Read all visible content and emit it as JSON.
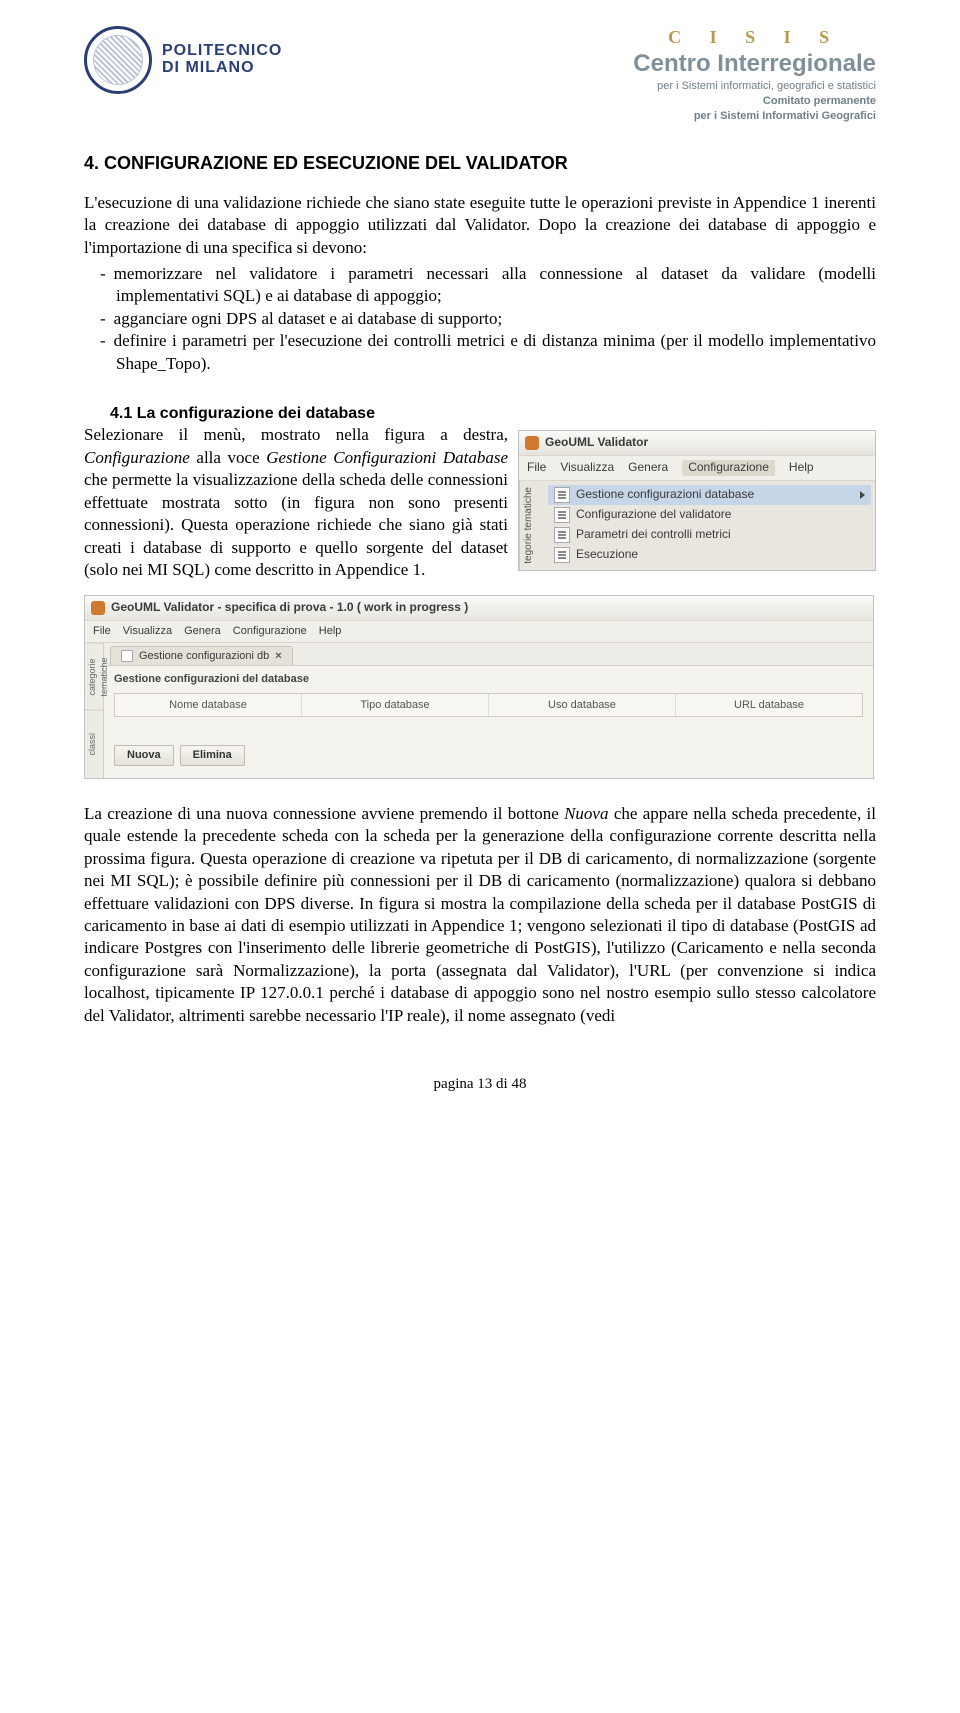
{
  "header": {
    "poli_line1": "POLITECNICO",
    "poli_line2": "DI MILANO",
    "cisis_letters": "C I S I S",
    "cisis_main": "Centro Interregionale",
    "cisis_sub1": "per i Sistemi informatici, geografici e statistici",
    "cisis_sub2": "Comitato permanente",
    "cisis_sub3": "per i Sistemi Informativi Geografici"
  },
  "section": {
    "title": "4. CONFIGURAZIONE ED ESECUZIONE DEL VALIDATOR",
    "para_intro": "L'esecuzione di una validazione richiede che siano state eseguite tutte le operazioni previste in Appendice 1 inerenti la creazione dei database di appoggio utilizzati dal Validator. Dopo la creazione dei database di appoggio e l'importazione di una specifica si devono:",
    "items": [
      "memorizzare nel validatore i parametri necessari alla connessione al dataset da validare (modelli implementativi SQL) e ai database di appoggio;",
      "agganciare ogni DPS al dataset e ai database di supporto;",
      "definire i parametri per l'esecuzione dei controlli metrici e di distanza minima (per il modello implementativo Shape_Topo)."
    ]
  },
  "sub41": {
    "title": "4.1 La configurazione dei database",
    "para_a": "Selezionare il menù, mostrato nella figura a destra, ",
    "term_config": "Configurazione",
    "para_b": " alla voce ",
    "term_gestione": "Gestione Configurazioni Database",
    "para_c": " che permette la visualizzazione della scheda delle connessioni effettuate mostrata sotto (in figura non sono presenti connessioni). Questa operazione richiede che siano già stati creati i database di supporto e quello sorgente del dataset (solo nei MI SQL) come descritto in Appendice 1."
  },
  "menu_fig": {
    "title": "GeoUML Validator",
    "menubar": [
      "File",
      "Visualizza",
      "Genera",
      "Configurazione",
      "Help"
    ],
    "side_tab": "tegorie tematiche",
    "items": [
      "Gestione configurazioni database",
      "Configurazione del validatore",
      "Parametri dei controlli metrici",
      "Esecuzione"
    ]
  },
  "db_fig": {
    "title": "GeoUML Validator - specifica di prova - 1.0 ( work in progress )",
    "menubar": [
      "File",
      "Visualizza",
      "Genera",
      "Configurazione",
      "Help"
    ],
    "side_labels": [
      "categorie tematiche",
      "classi"
    ],
    "tab_label": "Gestione configurazioni db",
    "panel_title": "Gestione configurazioni del database",
    "columns": [
      "Nome database",
      "Tipo database",
      "Uso database",
      "URL database"
    ],
    "buttons": [
      "Nuova",
      "Elimina"
    ]
  },
  "para_last": "La creazione di una nuova connessione avviene premendo il bottone <i>Nuova</i> che appare nella scheda precedente, il quale estende la precedente scheda con la scheda per la generazione della configurazione corrente descritta nella prossima figura. Questa operazione di creazione va ripetuta per il DB di caricamento, di normalizzazione (sorgente nei MI SQL); è possibile definire più connessioni per il DB di caricamento (normalizzazione) qualora si debbano effettuare validazioni con DPS diverse. In figura si mostra la compilazione della scheda per il database PostGIS di caricamento in base ai dati di esempio utilizzati in Appendice 1; vengono selezionati il tipo di database (PostGIS ad indicare Postgres con l'inserimento delle librerie geometriche di PostGIS), l'utilizzo (Caricamento e nella seconda configurazione sarà Normalizzazione), la porta (assegnata dal Validator), l'URL (per convenzione si indica localhost, tipicamente IP 127.0.0.1 perché i database di appoggio sono nel nostro esempio sullo stesso calcolatore del Validator, altrimenti sarebbe necessario l'IP reale), il nome assegnato (vedi",
  "footer": "pagina 13 di 48"
}
